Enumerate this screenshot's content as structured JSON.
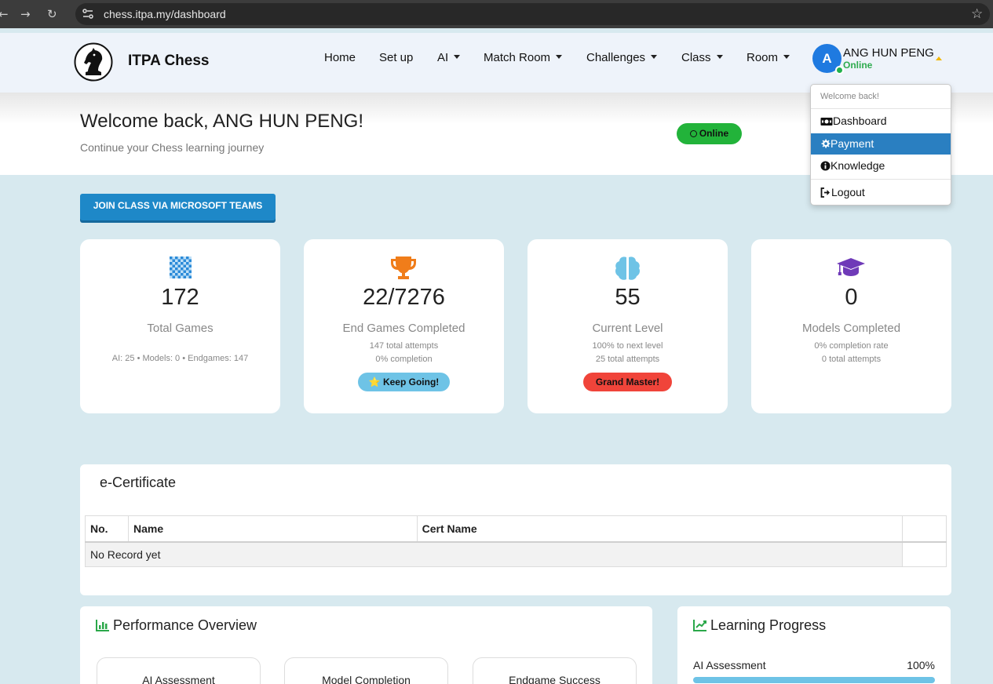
{
  "browser": {
    "url": "chess.itpa.my/dashboard",
    "icons": [
      "back-arrow-icon",
      "forward-arrow-icon",
      "reload-icon",
      "site-settings-icon",
      "bookmark-star-icon"
    ]
  },
  "nav": {
    "brand": "ITPA Chess",
    "items": [
      {
        "label": "Home",
        "dropdown": false
      },
      {
        "label": "Set up",
        "dropdown": false
      },
      {
        "label": "AI",
        "dropdown": true
      },
      {
        "label": "Match Room",
        "dropdown": true
      },
      {
        "label": "Challenges",
        "dropdown": true
      },
      {
        "label": "Class",
        "dropdown": true
      },
      {
        "label": "Room",
        "dropdown": true
      }
    ],
    "user": {
      "initial": "A",
      "name": "ANG HUN PENG",
      "status": "Online",
      "status_color": "#2eab4f",
      "avatar_color": "#1f7ae0"
    }
  },
  "user_menu": {
    "header": "Welcome back!",
    "items": [
      {
        "label": "Dashboard",
        "icon": "money-bill-icon",
        "active": false
      },
      {
        "label": "Payment",
        "icon": "gear-icon",
        "active": true
      },
      {
        "label": "Knowledge",
        "icon": "info-circle-icon",
        "active": false
      },
      {
        "label": "Logout",
        "icon": "logout-icon",
        "active": false
      }
    ]
  },
  "welcome": {
    "title": "Welcome back, ANG HUN PENG!",
    "subtitle": "Continue your Chess learning journey",
    "status_badge": "Online"
  },
  "actions": {
    "join_teams": "JOIN CLASS VIA MICROSOFT TEAMS"
  },
  "stats": [
    {
      "icon": "chessboard-icon",
      "value": "172",
      "label": "Total Games",
      "details": [
        "AI: 25 • Models: 0 • Endgames: 147"
      ],
      "badge": null
    },
    {
      "icon": "trophy-icon",
      "value": "22/7276",
      "label": "End Games Completed",
      "details": [
        "147 total attempts",
        "0% completion"
      ],
      "badge": "⭐ Keep Going!",
      "badge_color": "#6ec3e6"
    },
    {
      "icon": "brain-icon",
      "value": "55",
      "label": "Current Level",
      "details": [
        "100% to next level",
        "25 total attempts"
      ],
      "badge": "Grand Master!",
      "badge_color": "#f0443a"
    },
    {
      "icon": "graduation-cap-icon",
      "value": "0",
      "label": "Models Completed",
      "details": [
        "0% completion rate",
        "0 total attempts"
      ],
      "badge": null
    }
  ],
  "certificate": {
    "title": "e-Certificate",
    "columns": [
      "No.",
      "Name",
      "Cert Name",
      ""
    ],
    "empty_text": "No Record yet"
  },
  "performance": {
    "title": "Performance Overview",
    "cards": [
      "AI Assessment",
      "Model Completion",
      "Endgame Success"
    ]
  },
  "learning": {
    "title": "Learning Progress",
    "items": [
      {
        "label": "AI Assessment",
        "value": "100%",
        "percent": 100
      }
    ]
  }
}
